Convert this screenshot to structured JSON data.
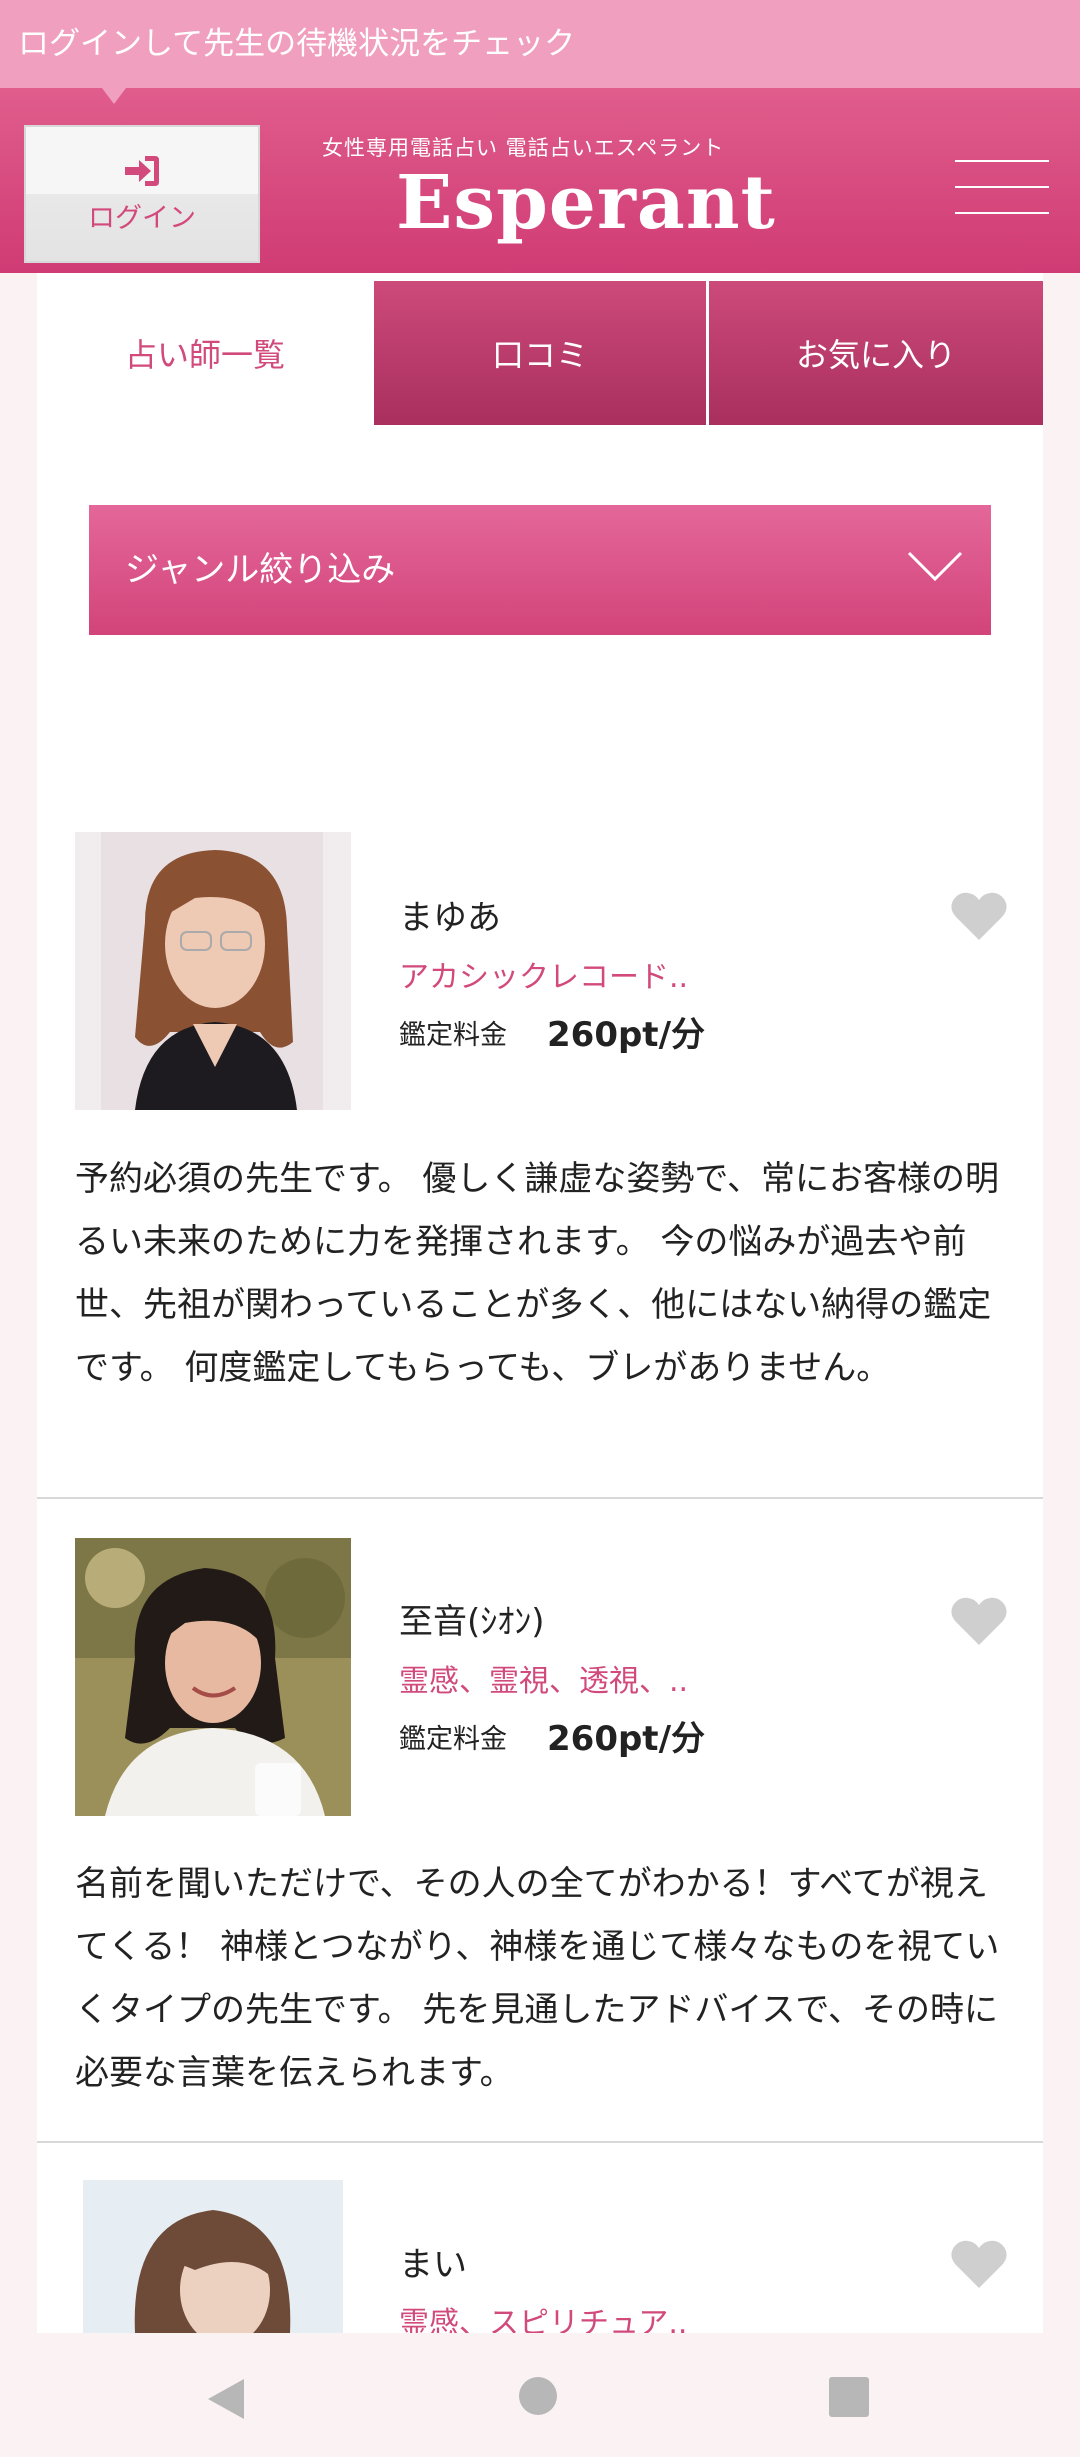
{
  "banner": {
    "text": "ログインして先生の待機状況をチェック"
  },
  "header": {
    "login_label": "ログイン",
    "tagline": "女性専用電話占い 電話占いエスペラント",
    "logo": "Esperant"
  },
  "tabs": [
    {
      "label": "占い師一覧"
    },
    {
      "label": "口コミ"
    },
    {
      "label": "お気に入り"
    }
  ],
  "genre_filter": {
    "label": "ジャンル絞り込み"
  },
  "fee_label": "鑑定料金",
  "fortune_tellers": [
    {
      "name": "まゆあ",
      "genres": "アカシックレコード..",
      "fee": "260pt/分",
      "description": "予約必須の先生です。 優しく謙虚な姿勢で、常にお客様の明るい未来のために力を発揮されます。 今の悩みが過去や前世、先祖が関わっていることが多く、他にはない納得の鑑定です。 何度鑑定してもらっても、ブレがありません。"
    },
    {
      "name": "至音(ｼｵﾝ)",
      "genres": "霊感、霊視、透視、..",
      "fee": "260pt/分",
      "description": "名前を聞いただけで、その人の全てがわかる！すべてが視えてくる！ 神様とつながり、神様を通じて様々なものを視ていくタイプの先生です。 先を見通したアドバイスで、その時に必要な言葉を伝えられます。"
    },
    {
      "name": "まい",
      "genres": "霊感、スピリチュア..",
      "fee": "",
      "description": ""
    }
  ],
  "colors": {
    "brand_pink": "#d24a7c",
    "banner_pink": "#f0a0be",
    "tab_dark": "#a92f5e",
    "heart_gray": "#cfcfcf"
  },
  "icons": [
    "login-icon",
    "menu-icon",
    "chevron-down-icon",
    "heart-icon",
    "back-icon",
    "home-icon",
    "recents-icon"
  ]
}
